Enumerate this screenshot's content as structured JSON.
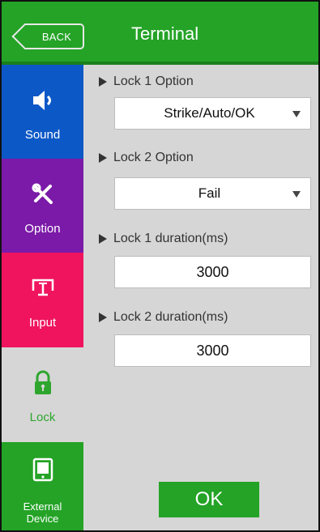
{
  "header": {
    "back_label": "BACK",
    "title": "Terminal"
  },
  "sidebar": {
    "items": [
      {
        "label": "Sound",
        "icon": "speaker-icon",
        "color": "#0d58c7"
      },
      {
        "label": "Option",
        "icon": "tools-icon",
        "color": "#7b1aa8"
      },
      {
        "label": "Input",
        "icon": "input-icon",
        "color": "#f0145e"
      },
      {
        "label": "Lock",
        "icon": "lock-icon",
        "color": "#d6d6d6",
        "selected": true
      },
      {
        "label": "External\nDevice",
        "label_line1": "External",
        "label_line2": "Device",
        "icon": "device-icon",
        "color": "#24a326"
      }
    ]
  },
  "settings": {
    "lock1_option": {
      "label": "Lock 1 Option",
      "value": "Strike/Auto/OK"
    },
    "lock2_option": {
      "label": "Lock 2 Option",
      "value": "Fail"
    },
    "lock1_duration": {
      "label": "Lock 1 duration(ms)",
      "value": "3000"
    },
    "lock2_duration": {
      "label": "Lock 2 duration(ms)",
      "value": "3000"
    }
  },
  "ok_label": "OK",
  "colors": {
    "accent": "#24a326",
    "background": "#d6d6d6"
  }
}
